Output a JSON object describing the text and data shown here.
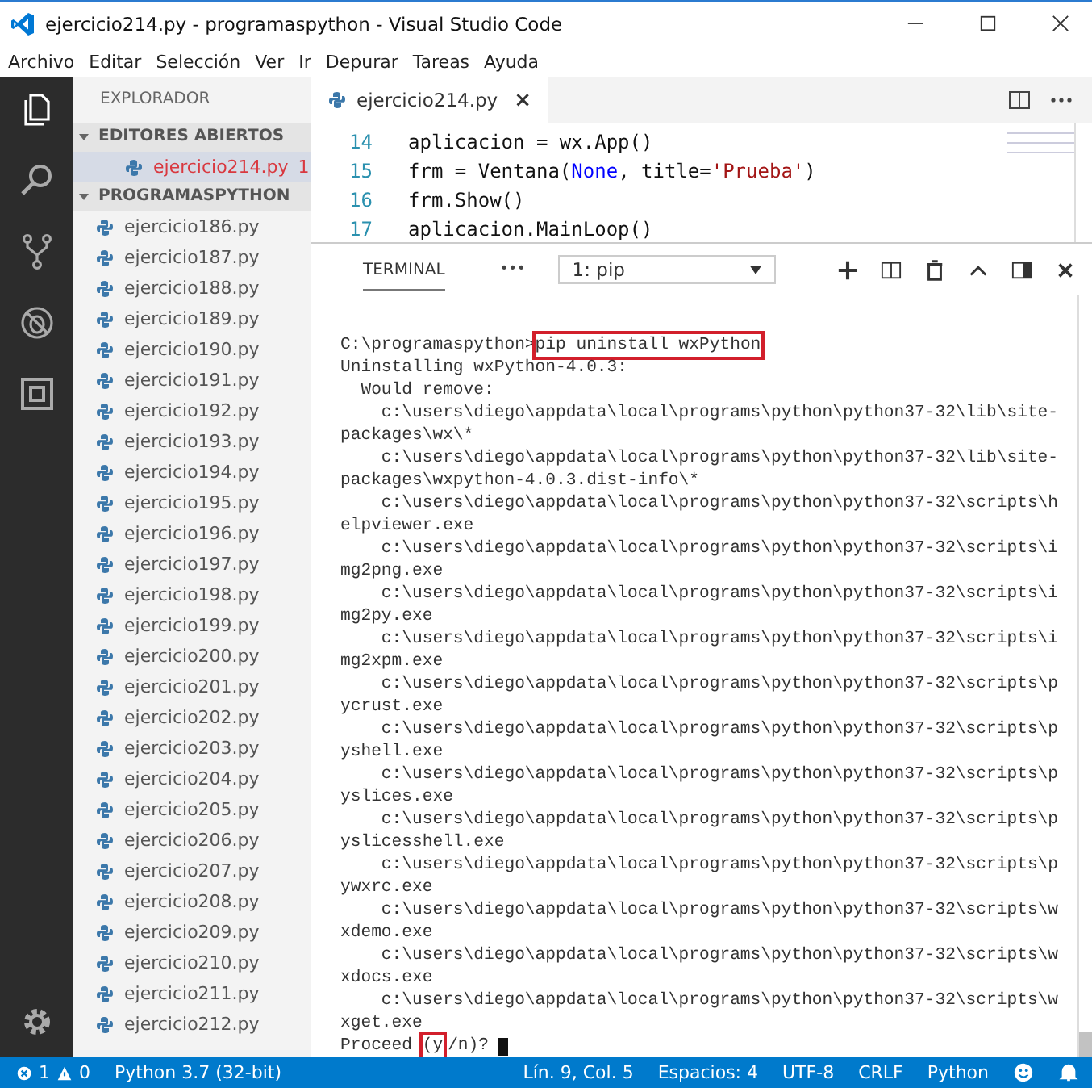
{
  "window": {
    "title": "ejercicio214.py - programaspython - Visual Studio Code"
  },
  "menu": [
    "Archivo",
    "Editar",
    "Selección",
    "Ver",
    "Ir",
    "Depurar",
    "Tareas",
    "Ayuda"
  ],
  "sidebar": {
    "title": "EXPLORADOR",
    "sections": [
      {
        "title": "EDITORES ABIERTOS",
        "expanded": true,
        "items": [
          {
            "name": "ejercicio214.py",
            "problems": "1",
            "selected": true,
            "error": true
          }
        ]
      },
      {
        "title": "PROGRAMASPYTHON",
        "expanded": true,
        "items": [
          {
            "name": "ejercicio186.py",
            "selected": false,
            "error": false
          },
          {
            "name": "ejercicio187.py",
            "selected": false,
            "error": false
          },
          {
            "name": "ejercicio188.py",
            "selected": false,
            "error": false
          },
          {
            "name": "ejercicio189.py",
            "selected": false,
            "error": false
          },
          {
            "name": "ejercicio190.py",
            "selected": false,
            "error": false
          },
          {
            "name": "ejercicio191.py",
            "selected": false,
            "error": false
          },
          {
            "name": "ejercicio192.py",
            "selected": false,
            "error": false
          },
          {
            "name": "ejercicio193.py",
            "selected": false,
            "error": false
          },
          {
            "name": "ejercicio194.py",
            "selected": false,
            "error": false
          },
          {
            "name": "ejercicio195.py",
            "selected": false,
            "error": false
          },
          {
            "name": "ejercicio196.py",
            "selected": false,
            "error": false
          },
          {
            "name": "ejercicio197.py",
            "selected": false,
            "error": false
          },
          {
            "name": "ejercicio198.py",
            "selected": false,
            "error": false
          },
          {
            "name": "ejercicio199.py",
            "selected": false,
            "error": false
          },
          {
            "name": "ejercicio200.py",
            "selected": false,
            "error": false
          },
          {
            "name": "ejercicio201.py",
            "selected": false,
            "error": false
          },
          {
            "name": "ejercicio202.py",
            "selected": false,
            "error": false
          },
          {
            "name": "ejercicio203.py",
            "selected": false,
            "error": false
          },
          {
            "name": "ejercicio204.py",
            "selected": false,
            "error": false
          },
          {
            "name": "ejercicio205.py",
            "selected": false,
            "error": false
          },
          {
            "name": "ejercicio206.py",
            "selected": false,
            "error": false
          },
          {
            "name": "ejercicio207.py",
            "selected": false,
            "error": false
          },
          {
            "name": "ejercicio208.py",
            "selected": false,
            "error": false
          },
          {
            "name": "ejercicio209.py",
            "selected": false,
            "error": false
          },
          {
            "name": "ejercicio210.py",
            "selected": false,
            "error": false
          },
          {
            "name": "ejercicio211.py",
            "selected": false,
            "error": false
          },
          {
            "name": "ejercicio212.py",
            "selected": false,
            "error": false
          }
        ]
      }
    ]
  },
  "editor": {
    "tabs": [
      {
        "name": "ejercicio214.py",
        "selected": true,
        "close": "×"
      }
    ],
    "lines": [
      {
        "number": "14",
        "tokens": [
          {
            "text": "aplicacion = wx.App()",
            "kind": "plain"
          }
        ]
      },
      {
        "number": "15",
        "tokens": [
          {
            "text": "frm = Ventana(",
            "kind": "plain"
          },
          {
            "text": "None",
            "kind": "keyword"
          },
          {
            "text": ", title=",
            "kind": "plain"
          },
          {
            "text": "'Prueba'",
            "kind": "string"
          },
          {
            "text": ")",
            "kind": "plain"
          }
        ]
      },
      {
        "number": "16",
        "tokens": [
          {
            "text": "frm.Show()",
            "kind": "plain"
          }
        ]
      },
      {
        "number": "17",
        "tokens": [
          {
            "text": "aplicacion.MainLoop()",
            "kind": "plain"
          }
        ]
      }
    ]
  },
  "panel": {
    "tabs": [
      {
        "label": "TERMINAL",
        "selected": true
      }
    ],
    "more": "•••",
    "terminal_select": "1: pip",
    "lines": [
      {
        "parts": [
          {
            "text": "C:\\programaspython>",
            "boxed": false
          },
          {
            "text": "pip uninstall wxPython",
            "boxed": true
          }
        ]
      },
      {
        "parts": [
          {
            "text": "Uninstalling wxPython-4.0.3:",
            "boxed": false
          }
        ]
      },
      {
        "parts": [
          {
            "text": "  Would remove:",
            "boxed": false
          }
        ]
      },
      {
        "parts": [
          {
            "text": "    c:\\users\\diego\\appdata\\local\\programs\\python\\python37-32\\lib\\site-",
            "boxed": false
          }
        ]
      },
      {
        "parts": [
          {
            "text": "packages\\wx\\*",
            "boxed": false
          }
        ]
      },
      {
        "parts": [
          {
            "text": "    c:\\users\\diego\\appdata\\local\\programs\\python\\python37-32\\lib\\site-",
            "boxed": false
          }
        ]
      },
      {
        "parts": [
          {
            "text": "packages\\wxpython-4.0.3.dist-info\\*",
            "boxed": false
          }
        ]
      },
      {
        "parts": [
          {
            "text": "    c:\\users\\diego\\appdata\\local\\programs\\python\\python37-32\\scripts\\h",
            "boxed": false
          }
        ]
      },
      {
        "parts": [
          {
            "text": "elpviewer.exe",
            "boxed": false
          }
        ]
      },
      {
        "parts": [
          {
            "text": "    c:\\users\\diego\\appdata\\local\\programs\\python\\python37-32\\scripts\\i",
            "boxed": false
          }
        ]
      },
      {
        "parts": [
          {
            "text": "mg2png.exe",
            "boxed": false
          }
        ]
      },
      {
        "parts": [
          {
            "text": "    c:\\users\\diego\\appdata\\local\\programs\\python\\python37-32\\scripts\\i",
            "boxed": false
          }
        ]
      },
      {
        "parts": [
          {
            "text": "mg2py.exe",
            "boxed": false
          }
        ]
      },
      {
        "parts": [
          {
            "text": "    c:\\users\\diego\\appdata\\local\\programs\\python\\python37-32\\scripts\\i",
            "boxed": false
          }
        ]
      },
      {
        "parts": [
          {
            "text": "mg2xpm.exe",
            "boxed": false
          }
        ]
      },
      {
        "parts": [
          {
            "text": "    c:\\users\\diego\\appdata\\local\\programs\\python\\python37-32\\scripts\\p",
            "boxed": false
          }
        ]
      },
      {
        "parts": [
          {
            "text": "ycrust.exe",
            "boxed": false
          }
        ]
      },
      {
        "parts": [
          {
            "text": "    c:\\users\\diego\\appdata\\local\\programs\\python\\python37-32\\scripts\\p",
            "boxed": false
          }
        ]
      },
      {
        "parts": [
          {
            "text": "yshell.exe",
            "boxed": false
          }
        ]
      },
      {
        "parts": [
          {
            "text": "    c:\\users\\diego\\appdata\\local\\programs\\python\\python37-32\\scripts\\p",
            "boxed": false
          }
        ]
      },
      {
        "parts": [
          {
            "text": "yslices.exe",
            "boxed": false
          }
        ]
      },
      {
        "parts": [
          {
            "text": "    c:\\users\\diego\\appdata\\local\\programs\\python\\python37-32\\scripts\\p",
            "boxed": false
          }
        ]
      },
      {
        "parts": [
          {
            "text": "yslicesshell.exe",
            "boxed": false
          }
        ]
      },
      {
        "parts": [
          {
            "text": "    c:\\users\\diego\\appdata\\local\\programs\\python\\python37-32\\scripts\\p",
            "boxed": false
          }
        ]
      },
      {
        "parts": [
          {
            "text": "ywxrc.exe",
            "boxed": false
          }
        ]
      },
      {
        "parts": [
          {
            "text": "    c:\\users\\diego\\appdata\\local\\programs\\python\\python37-32\\scripts\\w",
            "boxed": false
          }
        ]
      },
      {
        "parts": [
          {
            "text": "xdemo.exe",
            "boxed": false
          }
        ]
      },
      {
        "parts": [
          {
            "text": "    c:\\users\\diego\\appdata\\local\\programs\\python\\python37-32\\scripts\\w",
            "boxed": false
          }
        ]
      },
      {
        "parts": [
          {
            "text": "xdocs.exe",
            "boxed": false
          }
        ]
      },
      {
        "parts": [
          {
            "text": "    c:\\users\\diego\\appdata\\local\\programs\\python\\python37-32\\scripts\\w",
            "boxed": false
          }
        ]
      },
      {
        "parts": [
          {
            "text": "xget.exe",
            "boxed": false
          }
        ]
      },
      {
        "parts": [
          {
            "text": "Proceed ",
            "boxed": false
          },
          {
            "text": "(y",
            "boxed": true
          },
          {
            "text": "/n)? ",
            "boxed": false
          }
        ],
        "cursor": true
      }
    ]
  },
  "status_bar": {
    "errors": "1",
    "warnings": "0",
    "interpreter": "Python 3.7 (32-bit)",
    "position": "Lín. 9, Col. 5",
    "indent": "Espacios: 4",
    "encoding": "UTF-8",
    "eol": "CRLF",
    "language": "Python"
  }
}
